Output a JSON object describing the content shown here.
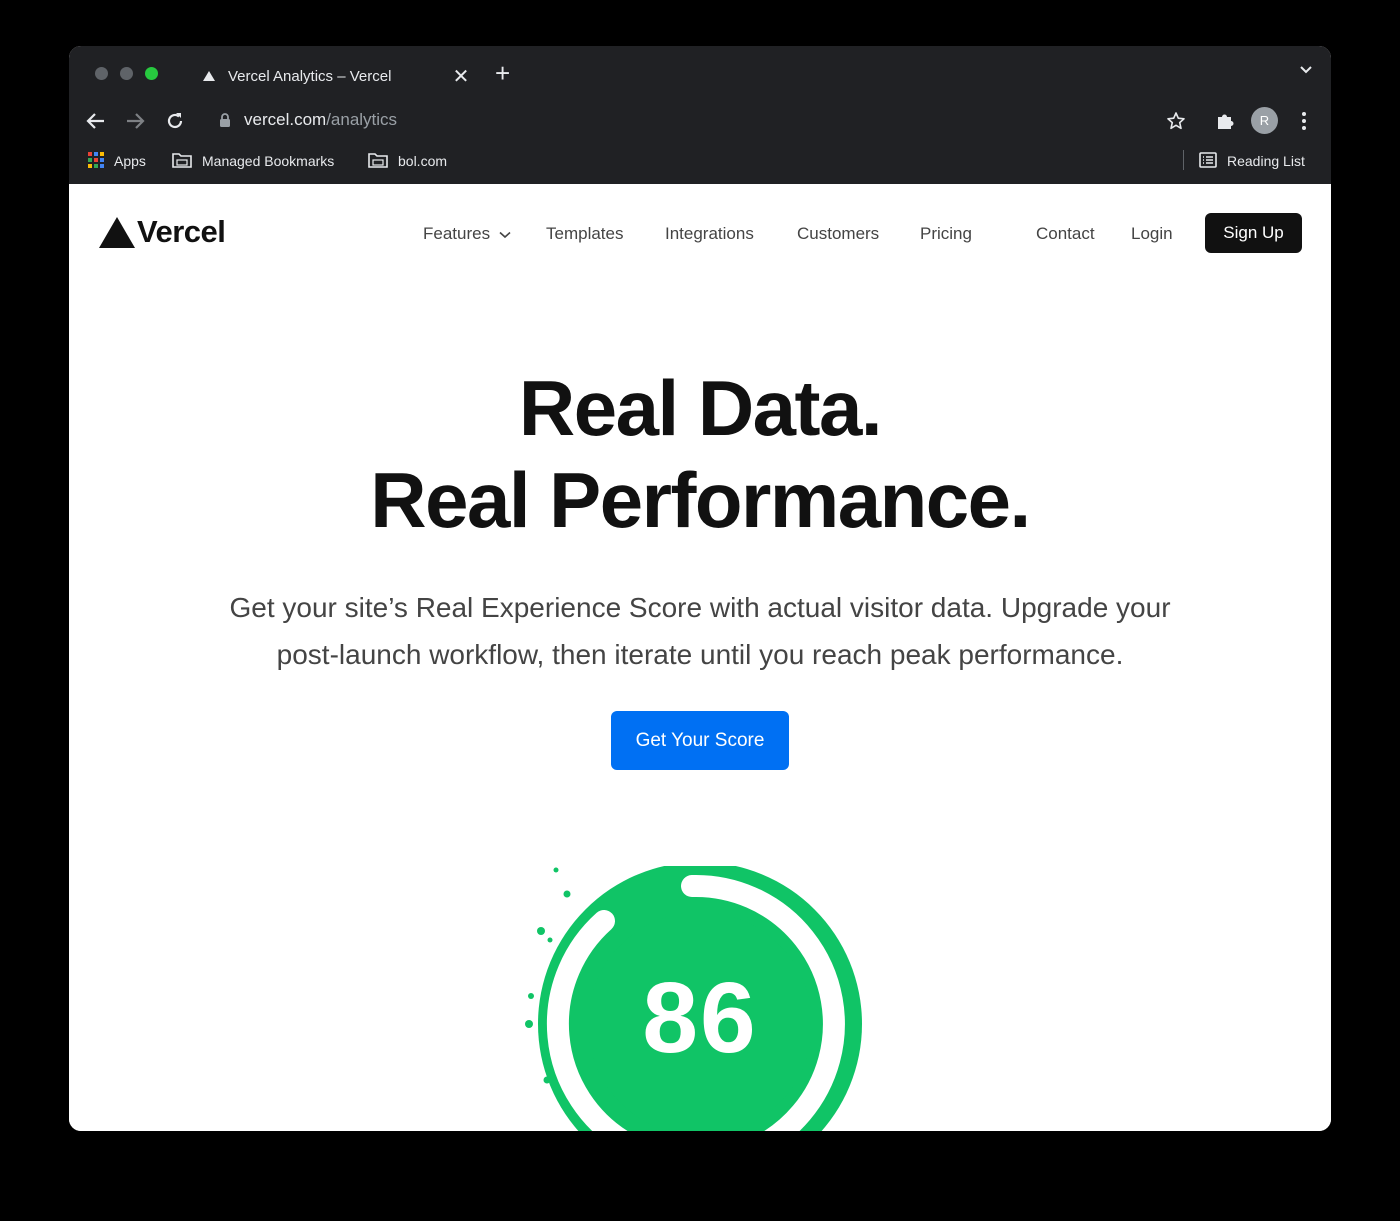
{
  "browser": {
    "tab_title": "Vercel Analytics – Vercel",
    "new_tab_symbol": "+",
    "close_symbol": "✕",
    "url_host": "vercel.com",
    "url_path": "/analytics",
    "avatar_letter": "R",
    "bookmarks": [
      {
        "label": "Apps",
        "icon": "apps-grid-icon"
      },
      {
        "label": "Managed Bookmarks",
        "icon": "folder-icon"
      },
      {
        "label": "bol.com",
        "icon": "folder-icon"
      }
    ],
    "reading_list": "Reading List"
  },
  "site": {
    "logo_text": "Vercel",
    "nav": {
      "features": "Features",
      "templates": "Templates",
      "integrations": "Integrations",
      "customers": "Customers",
      "pricing": "Pricing",
      "contact": "Contact",
      "login": "Login",
      "signup": "Sign Up"
    },
    "hero": {
      "title_line1": "Real Data.",
      "title_line2": "Real Performance.",
      "subtitle_line1": "Get your site’s Real Experience Score with actual visitor data. Upgrade your",
      "subtitle_line2": "post-launch workflow, then iterate until you reach peak performance.",
      "cta": "Get Your Score"
    },
    "score": {
      "value": "86",
      "color": "#10c466"
    }
  },
  "colors": {
    "chrome_bg": "#202124",
    "accent_blue": "#0070f3",
    "text_dark": "#111111"
  }
}
